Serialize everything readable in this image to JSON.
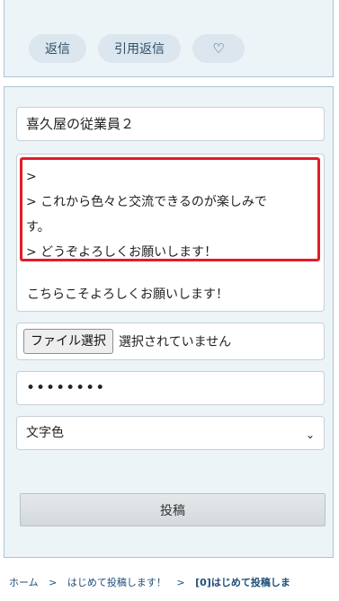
{
  "top_actions": {
    "reply_label": "返信",
    "quote_reply_label": "引用返信",
    "like_icon": "heart-icon"
  },
  "form": {
    "name_value": "喜久屋の従業員２",
    "message": {
      "quoted_lines": [
        ">",
        "> これから色々と交流できるのが楽しみで",
        "す。",
        "> どうぞよろしくお願いします！"
      ],
      "reply_text": "こちらこそよろしくお願いします！"
    },
    "file_button_label": "ファイル選択",
    "file_status_text": "選択されていません",
    "password_value": "••••••••",
    "text_color_select_value": "文字色",
    "submit_label": "投稿"
  },
  "breadcrumb": {
    "home": "ホーム",
    "separator": ">",
    "parent": "はじめて投稿します！",
    "current": "[0]はじめて投稿しま"
  },
  "colors": {
    "panel_bg": "#edf4f8",
    "panel_border": "#a9c3d3",
    "pill_bg": "#dbe6ee",
    "highlight_red": "#e11d2a",
    "link_blue": "#1f4e79"
  }
}
